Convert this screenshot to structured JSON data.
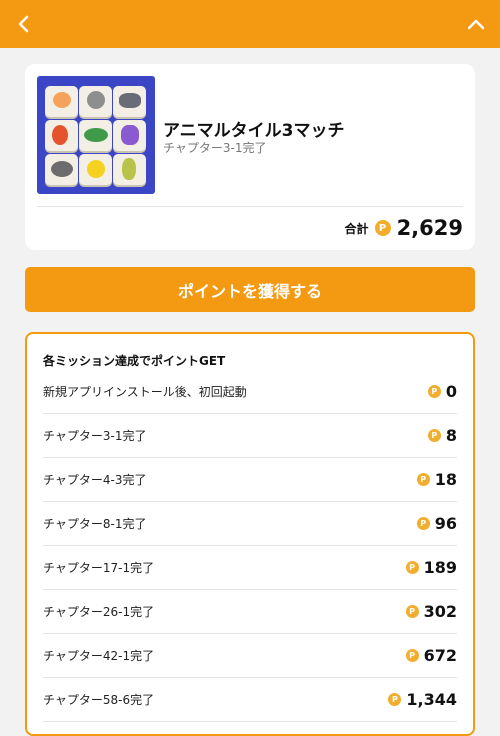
{
  "header": {
    "back_icon": "chevron-left-icon",
    "collapse_icon": "chevron-up-icon",
    "color": "#f39a12"
  },
  "app": {
    "title": "アニマルタイル3マッチ",
    "subtitle": "チャプター3-1完了",
    "total_label": "合計",
    "points_symbol": "P",
    "total_points": "2,629"
  },
  "cta": {
    "label": "ポイントを獲得する"
  },
  "missions": {
    "heading": "各ミッション達成でポイントGET",
    "items": [
      {
        "label": "新規アプリインストール後、初回起動",
        "points": "0"
      },
      {
        "label": "チャプター3-1完了",
        "points": "8"
      },
      {
        "label": "チャプター4-3完了",
        "points": "18"
      },
      {
        "label": "チャプター8-1完了",
        "points": "96"
      },
      {
        "label": "チャプター17-1完了",
        "points": "189"
      },
      {
        "label": "チャプター26-1完了",
        "points": "302"
      },
      {
        "label": "チャプター42-1完了",
        "points": "672"
      },
      {
        "label": "チャプター58-6完了",
        "points": "1,344"
      }
    ]
  }
}
